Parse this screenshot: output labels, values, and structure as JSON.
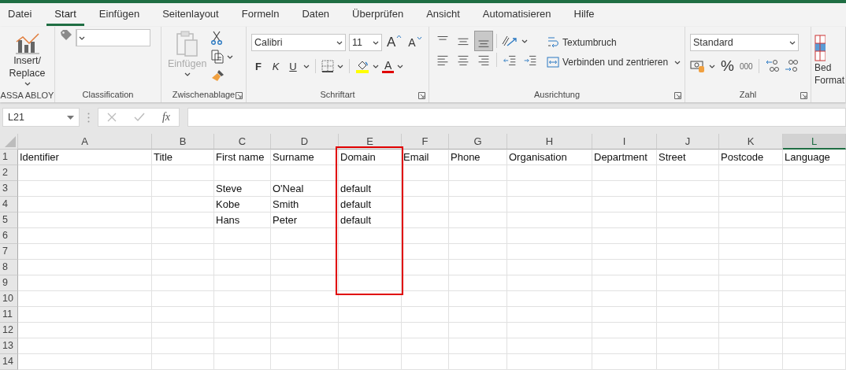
{
  "tabs": [
    {
      "label": "Datei",
      "selected": false
    },
    {
      "label": "Start",
      "selected": true
    },
    {
      "label": "Einfügen",
      "selected": false
    },
    {
      "label": "Seitenlayout",
      "selected": false
    },
    {
      "label": "Formeln",
      "selected": false
    },
    {
      "label": "Daten",
      "selected": false
    },
    {
      "label": "Überprüfen",
      "selected": false
    },
    {
      "label": "Ansicht",
      "selected": false
    },
    {
      "label": "Automatisieren",
      "selected": false
    },
    {
      "label": "Hilfe",
      "selected": false
    }
  ],
  "ribbon": {
    "groups": [
      {
        "kind": "insert",
        "label": "ASSA ABLOY",
        "button": [
          "Insert/",
          "Replace"
        ]
      },
      {
        "kind": "classification",
        "label": "Classification"
      },
      {
        "kind": "clipboard",
        "label": "Zwischenablage",
        "paste": {
          "label": "Einfügen",
          "disabled": true
        },
        "launcher": true
      },
      {
        "kind": "font",
        "label": "Schriftart",
        "font_name": "Calibri",
        "font_size": "11",
        "grow": "A",
        "shrink": "A",
        "bold": "F",
        "italic": "K",
        "underline": "U",
        "font_color": "A",
        "launcher": true
      },
      {
        "kind": "alignment",
        "label": "Ausrichtung",
        "vertical_align": [
          {
            "selected": false
          },
          {
            "selected": false
          },
          {
            "selected": true
          }
        ],
        "wrap": "Textumbruch",
        "merge": "Verbinden und zentrieren",
        "launcher": true
      },
      {
        "kind": "number",
        "label": "Zahl",
        "format": "Standard",
        "percent": "%",
        "thousands": "000",
        "launcher": true
      },
      {
        "kind": "conditional",
        "button": [
          "Bed",
          "Format"
        ]
      }
    ]
  },
  "formula_bar": {
    "name_box": "L21",
    "function_label": "fx"
  },
  "sheet": {
    "columns": [
      {
        "letter": "A",
        "selected": false,
        "highlighted": false
      },
      {
        "letter": "B",
        "selected": false,
        "highlighted": false
      },
      {
        "letter": "C",
        "selected": false,
        "highlighted": false
      },
      {
        "letter": "D",
        "selected": false,
        "highlighted": false
      },
      {
        "letter": "E",
        "selected": false,
        "highlighted": true
      },
      {
        "letter": "F",
        "selected": false,
        "highlighted": false
      },
      {
        "letter": "G",
        "selected": false,
        "highlighted": false
      },
      {
        "letter": "H",
        "selected": false,
        "highlighted": false
      },
      {
        "letter": "I",
        "selected": false,
        "highlighted": false
      },
      {
        "letter": "J",
        "selected": false,
        "highlighted": false
      },
      {
        "letter": "K",
        "selected": false,
        "highlighted": false
      },
      {
        "letter": "L",
        "selected": true,
        "highlighted": false
      }
    ],
    "rows": [
      {
        "number": "1",
        "cells": [
          "Identifier",
          "Title",
          "First name",
          "Surname",
          "Domain",
          "Email",
          "Phone",
          "Organisation",
          "Department",
          "Street",
          "Postcode",
          "Language"
        ]
      },
      {
        "number": "2"
      },
      {
        "number": "3",
        "cells": [
          null,
          null,
          "Steve",
          "O'Neal",
          "default"
        ]
      },
      {
        "number": "4",
        "cells": [
          null,
          null,
          "Kobe",
          "Smith",
          "default"
        ]
      },
      {
        "number": "5",
        "cells": [
          null,
          null,
          "Hans",
          "Peter",
          "default"
        ]
      },
      {
        "number": "6"
      },
      {
        "number": "7"
      },
      {
        "number": "8"
      },
      {
        "number": "9"
      },
      {
        "number": "10"
      },
      {
        "number": "11"
      },
      {
        "number": "12"
      },
      {
        "number": "13"
      },
      {
        "number": "14"
      }
    ]
  }
}
